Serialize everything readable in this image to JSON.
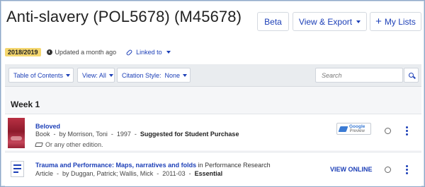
{
  "header": {
    "title": "Anti-slavery (POL5678) (M45678)",
    "beta_label": "Beta",
    "export_label": "View & Export",
    "mylists_label": "My Lists"
  },
  "meta": {
    "year_badge": "2018/2019",
    "updated_text": "Updated a month ago",
    "linked_label": "Linked to"
  },
  "toolbar": {
    "toc_label": "Table of Contents",
    "view_label": "View: All",
    "citation_label": "Citation Style:  None",
    "search_placeholder": "Search"
  },
  "section": {
    "title": "Week 1"
  },
  "items": [
    {
      "title": "Beloved",
      "type": "Book",
      "by": "by Morrison, Toni",
      "year": "1997",
      "importance": "Suggested for Student Purchase",
      "note": "Or any other edition.",
      "badge_line1": "Google",
      "badge_line2": "Preview"
    },
    {
      "title": "Trauma and Performance: Maps, narratives and folds",
      "container": "in Performance Research",
      "type": "Article",
      "by": "by Duggan, Patrick; Wallis, Mick",
      "year": "2011-03",
      "importance": "Essential",
      "action_label": "VIEW ONLINE"
    }
  ],
  "colors": {
    "accent": "#1c3fb7",
    "year_badge": "#f5d76e",
    "toolbar_bg": "#e9ecef"
  },
  "icons": [
    "clock-icon",
    "link-icon",
    "search-icon",
    "plus-icon",
    "graduation-cap-icon",
    "kebab-menu-icon"
  ]
}
